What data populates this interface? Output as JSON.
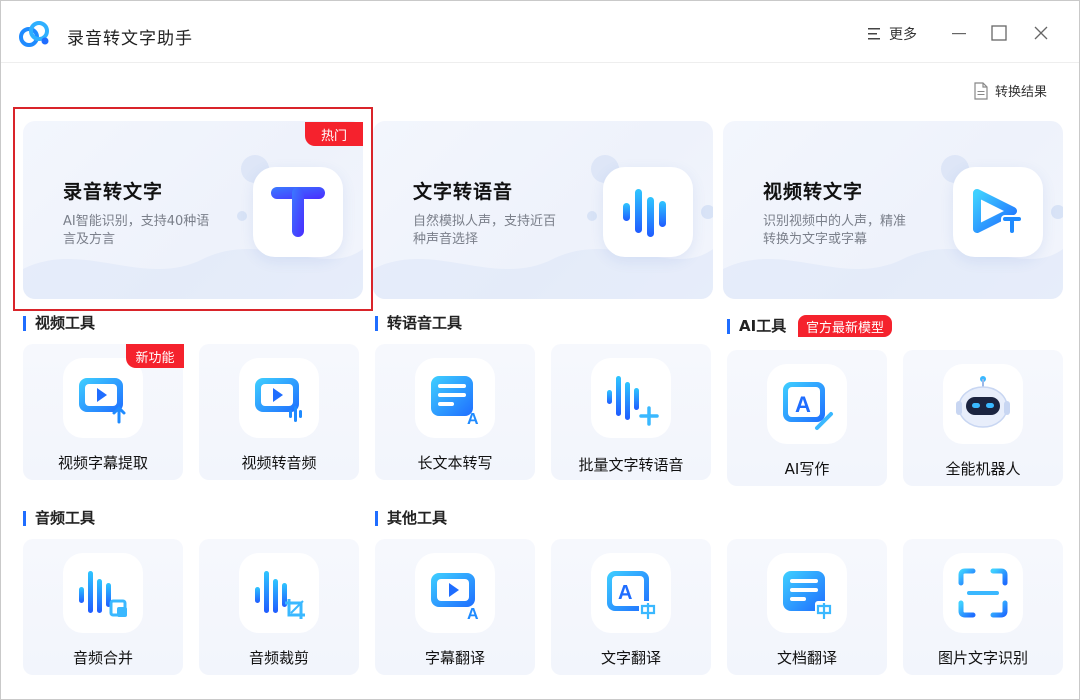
{
  "window": {
    "title": "录音转文字助手",
    "more_label": "更多",
    "result_label": "转换结果"
  },
  "big_cards": [
    {
      "title": "录音转文字",
      "desc": "AI智能识别，支持40种语言及方言",
      "badge": "热门",
      "icon": "text-t-icon"
    },
    {
      "title": "文字转语音",
      "desc": "自然模拟人声，支持近百种声音选择",
      "icon": "sound-wave-icon"
    },
    {
      "title": "视频转文字",
      "desc": "识别视频中的人声，精准转换为文字或字幕",
      "icon": "video-text-icon"
    }
  ],
  "sections": {
    "video_tools": "视频工具",
    "tts_tools": "转语音工具",
    "ai_tools": "AI工具",
    "ai_badge": "官方最新模型",
    "audio_tools": "音频工具",
    "other_tools": "其他工具"
  },
  "tools_row1": [
    {
      "label": "视频字幕提取",
      "badge": "新功能",
      "icon": "video-subtitle-icon"
    },
    {
      "label": "视频转音频",
      "icon": "video-audio-icon"
    },
    {
      "label": "长文本转写",
      "icon": "long-text-icon"
    },
    {
      "label": "批量文字转语音",
      "icon": "batch-tts-icon"
    },
    {
      "label": "AI写作",
      "icon": "ai-writing-icon"
    },
    {
      "label": "全能机器人",
      "icon": "robot-icon"
    }
  ],
  "tools_row2": [
    {
      "label": "音频合并",
      "icon": "audio-merge-icon"
    },
    {
      "label": "音频裁剪",
      "icon": "audio-crop-icon"
    },
    {
      "label": "字幕翻译",
      "icon": "subtitle-translate-icon"
    },
    {
      "label": "文字翻译",
      "icon": "text-translate-icon"
    },
    {
      "label": "文档翻译",
      "icon": "doc-translate-icon"
    },
    {
      "label": "图片文字识别",
      "icon": "ocr-icon"
    }
  ],
  "colors": {
    "accent": "#1f6dff",
    "badge_red": "#f5222d",
    "highlight_red": "#d9242a"
  }
}
